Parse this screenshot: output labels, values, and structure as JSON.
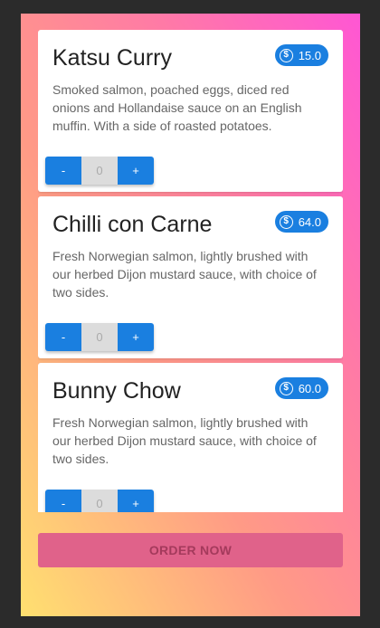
{
  "menu": {
    "items": [
      {
        "name": "Katsu Curry",
        "price": "15.0",
        "description": "Smoked salmon, poached eggs, diced red onions and Hollandaise sauce on an English muffin. With a side of roasted potatoes.",
        "quantity": "0",
        "minus_label": "-",
        "plus_label": "+"
      },
      {
        "name": "Chilli con Carne",
        "price": "64.0",
        "description": "Fresh Norwegian salmon, lightly brushed with our herbed Dijon mustard sauce, with choice of two sides.",
        "quantity": "0",
        "minus_label": "-",
        "plus_label": "+"
      },
      {
        "name": "Bunny Chow",
        "price": "60.0",
        "description": "Fresh Norwegian salmon, lightly brushed with our herbed Dijon mustard sauce, with choice of two sides.",
        "quantity": "0",
        "minus_label": "-",
        "plus_label": "+"
      }
    ]
  },
  "order_button": {
    "label": "ORDER NOW"
  },
  "icons": {
    "price": "dollar-coin-icon"
  },
  "colors": {
    "accent": "#1a7fe0",
    "order_button": "#e0628a",
    "order_text": "#a43a5c",
    "gradient": [
      "#ffe070",
      "#ff9a86",
      "#ff7aa6",
      "#ff56d4"
    ]
  }
}
